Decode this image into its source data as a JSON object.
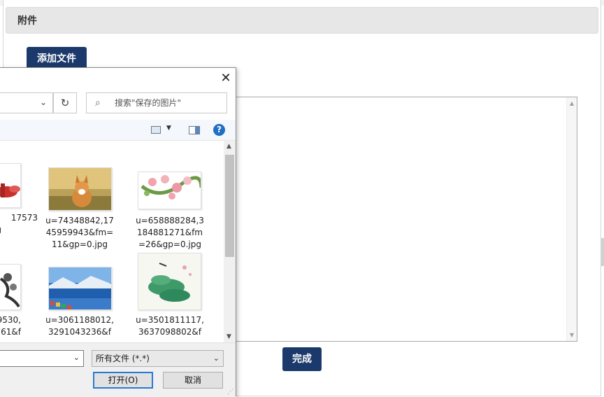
{
  "panel": {
    "title": "附件"
  },
  "buttons": {
    "add_file": "添加文件",
    "finish": "完成"
  },
  "dialog": {
    "close_symbol": "✕",
    "refresh_symbol": "↻",
    "search_placeholder": "搜索\"保存的图片\"",
    "help_symbol": "?",
    "files": [
      {
        "name_lines": [
          "17573",
          "g"
        ],
        "thumb": "red-ribbon"
      },
      {
        "name_lines": [
          "u=74348842,17",
          "45959943&fm=",
          "11&gp=0.jpg"
        ],
        "thumb": "corgi"
      },
      {
        "name_lines": [
          "u=658888284,3",
          "184881271&fm",
          "=26&gp=0.jpg"
        ],
        "thumb": "roses"
      },
      {
        "name_lines": [
          "9530,",
          "761&f"
        ],
        "thumb": "ink-wash"
      },
      {
        "name_lines": [
          "u=3061188012,",
          "3291043236&f"
        ],
        "thumb": "lake"
      },
      {
        "name_lines": [
          "u=3501811117,",
          "3637098802&f"
        ],
        "thumb": "green-ink"
      }
    ],
    "filetype_value": "所有文件 (*.*)",
    "open_label": "打开(O)",
    "cancel_label": "取消"
  },
  "colors": {
    "primary": "#1b3a6b",
    "focus": "#2b78d4",
    "help": "#1f6fc4"
  }
}
